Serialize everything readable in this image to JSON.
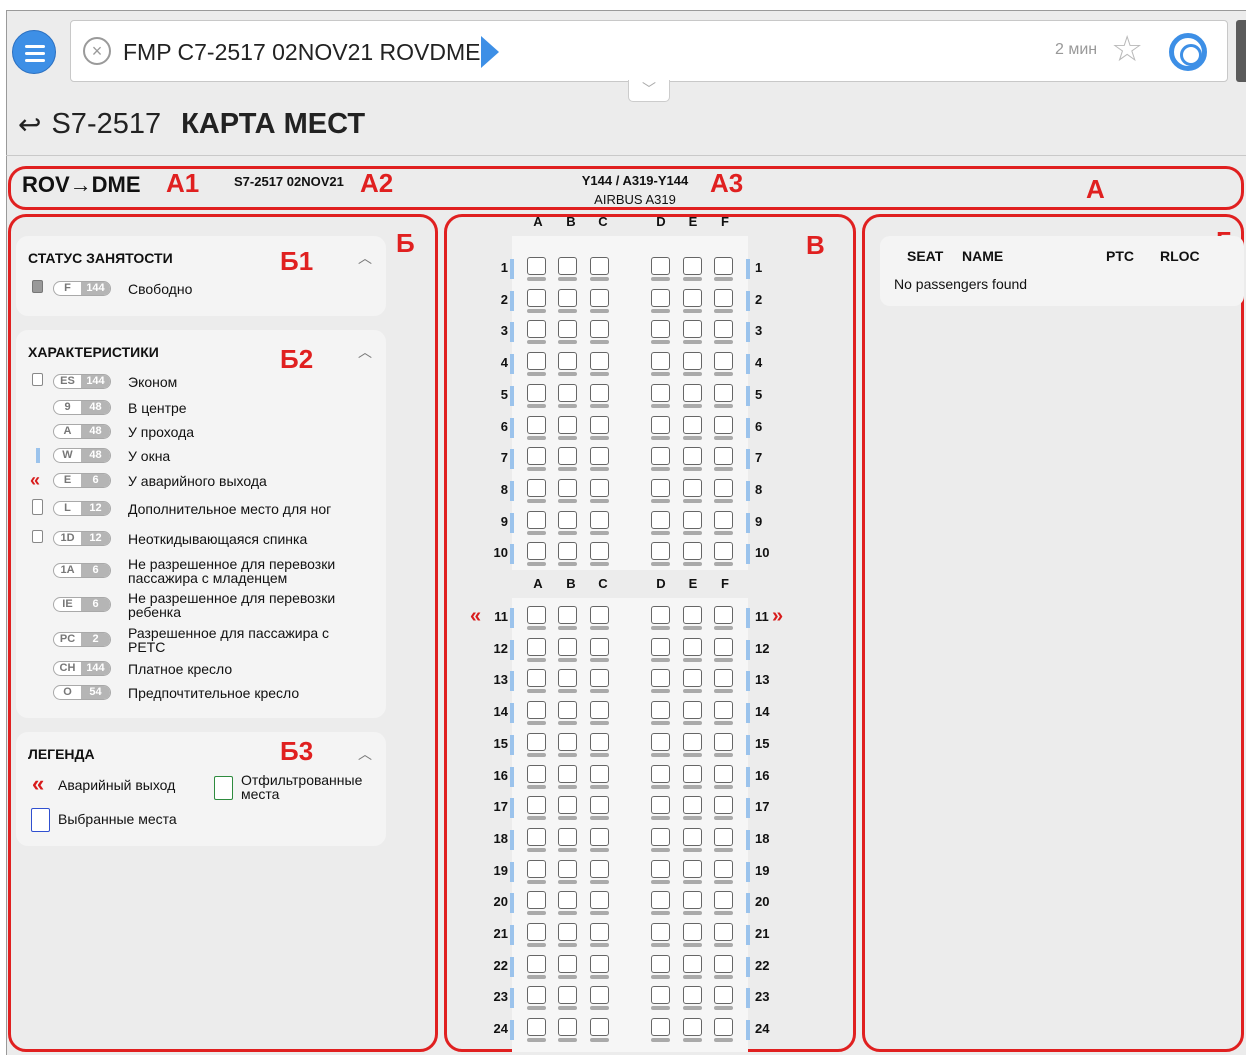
{
  "command": {
    "text": "FMP C7-2517 02NOV21 ROVDME",
    "time_ago": "2 мин"
  },
  "header": {
    "back_icon": "↩",
    "flight": "S7-2517",
    "title": "КАРТА МЕСТ"
  },
  "flight_bar": {
    "route": "ROV→DME",
    "flight_date": "S7-2517 02NOV21",
    "config": "Y144 / A319-Y144",
    "aircraft": "AIRBUS A319"
  },
  "annotations": {
    "A": "А",
    "A1": "А1",
    "A2": "А2",
    "A3": "А3",
    "B": "Б",
    "B1": "Б1",
    "B2": "Б2",
    "B3": "Б3",
    "V": "В",
    "G": "Г"
  },
  "occupancy": {
    "title": "СТАТУС ЗАНЯТОСТИ",
    "items": [
      {
        "code": "F",
        "count": "144",
        "label": "Свободно"
      }
    ]
  },
  "characteristics": {
    "title": "ХАРАКТЕРИСТИКИ",
    "items": [
      {
        "code": "ES",
        "count": "144",
        "label": "Эконом",
        "label2": ""
      },
      {
        "code": "9",
        "count": "48",
        "label": "В центре",
        "label2": ""
      },
      {
        "code": "A",
        "count": "48",
        "label": "У прохода",
        "label2": ""
      },
      {
        "code": "W",
        "count": "48",
        "label": "У окна",
        "label2": ""
      },
      {
        "code": "E",
        "count": "6",
        "label": "У аварийного выхода",
        "label2": ""
      },
      {
        "code": "L",
        "count": "12",
        "label": "Дополнительное место для ног",
        "label2": ""
      },
      {
        "code": "1D",
        "count": "12",
        "label": "Неоткидывающаяся спинка",
        "label2": ""
      },
      {
        "code": "1A",
        "count": "6",
        "label": "Не разрешенное для перевозки",
        "label2": "пассажира с младенцем"
      },
      {
        "code": "IE",
        "count": "6",
        "label": "Не разрешенное для перевозки",
        "label2": "ребенка"
      },
      {
        "code": "PC",
        "count": "2",
        "label": "Разрешенное для пассажира с",
        "label2": "PETC"
      },
      {
        "code": "CH",
        "count": "144",
        "label": "Платное кресло",
        "label2": ""
      },
      {
        "code": "O",
        "count": "54",
        "label": "Предпочтительное кресло",
        "label2": ""
      }
    ]
  },
  "legend": {
    "title": "ЛЕГЕНДА",
    "emergency": "Аварийный выход",
    "filtered": "Отфильтрованные места",
    "filtered_l1": "Отфильтрованные",
    "filtered_l2": "места",
    "selected": "Выбранные места"
  },
  "seatmap": {
    "columns": [
      "A",
      "B",
      "C",
      "D",
      "E",
      "F"
    ],
    "rows": [
      "1",
      "2",
      "3",
      "4",
      "5",
      "6",
      "7",
      "8",
      "9",
      "10",
      "11",
      "12",
      "13",
      "14",
      "15",
      "16",
      "17",
      "18",
      "19",
      "20",
      "21",
      "22",
      "23",
      "24"
    ],
    "exit_row": "11"
  },
  "passengers": {
    "headers": [
      "SEAT",
      "NAME",
      "PTC",
      "RLOC"
    ],
    "empty": "No passengers found"
  },
  "colors": {
    "accent": "#3d8fe6",
    "annotation": "#e02020",
    "window_marker": "#9bc3ec"
  }
}
